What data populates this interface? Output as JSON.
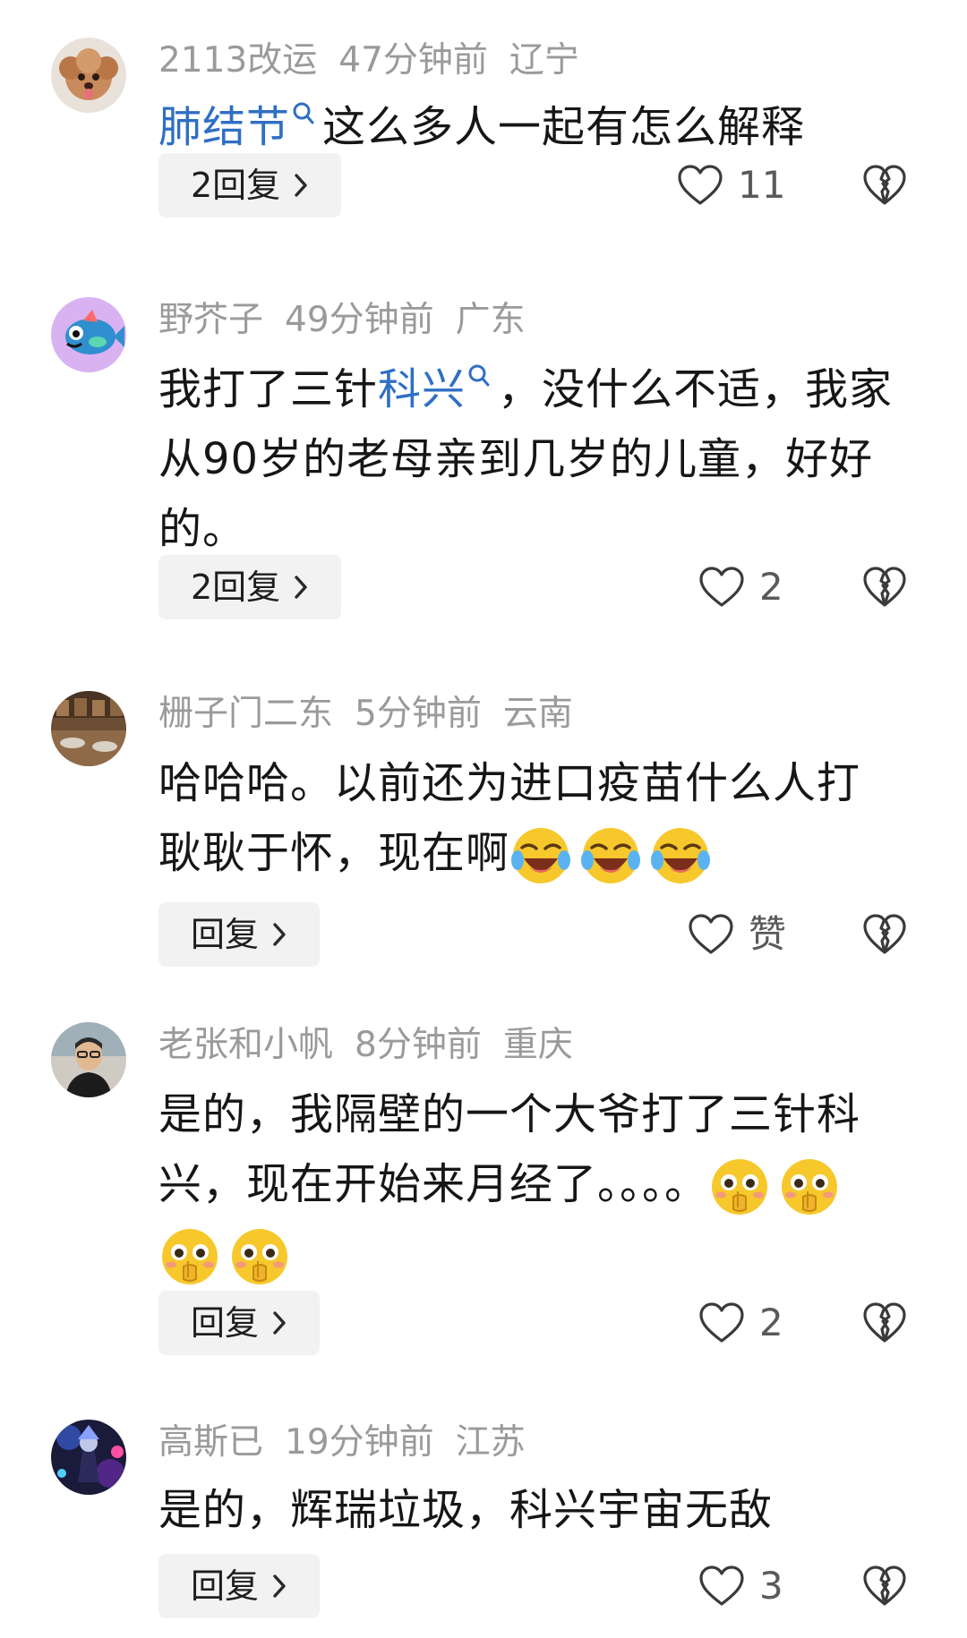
{
  "comments": [
    {
      "username": "2113改运",
      "time": "47分钟前",
      "location": "辽宁",
      "topic": "肺结节",
      "text_after_topic": "这么多人一起有怎么解释",
      "reply_label": "2回复",
      "like_count": "11"
    },
    {
      "username": "野芥子",
      "time": "49分钟前",
      "location": "广东",
      "text_before_topic": "我打了三针",
      "topic": "科兴",
      "text_after_topic": "，没什么不适，我家从90岁的老母亲到几岁的儿童，好好的。",
      "reply_label": "2回复",
      "like_count": "2"
    },
    {
      "username": "栅子门二东",
      "time": "5分钟前",
      "location": "云南",
      "text": "哈哈哈。以前还为进口疫苗什么人打耿耿于怀，现在啊",
      "emoji": [
        "laughing-crying-emoji",
        "laughing-crying-emoji",
        "laughing-crying-emoji"
      ],
      "reply_label": "回复",
      "like_count": "赞"
    },
    {
      "username": "老张和小帆",
      "time": "8分钟前",
      "location": "重庆",
      "text": "是的，我隔壁的一个大爷打了三针科兴，现在开始来月经了。。。。",
      "emoji": [
        "shocked-emoji",
        "shocked-emoji",
        "shocked-emoji",
        "shocked-emoji"
      ],
      "reply_label": "回复",
      "like_count": "2"
    },
    {
      "username": "高斯已",
      "time": "19分钟前",
      "location": "江苏",
      "text": "是的，辉瑞垃圾，科兴宇宙无敌",
      "reply_label": "回复",
      "like_count": "3"
    }
  ],
  "colors": {
    "topic_link": "#2f6fc4",
    "meta_text": "#9a9a9a",
    "reply_button_bg": "#f2f2f2",
    "emoji_yellow": "#f7c82c"
  }
}
